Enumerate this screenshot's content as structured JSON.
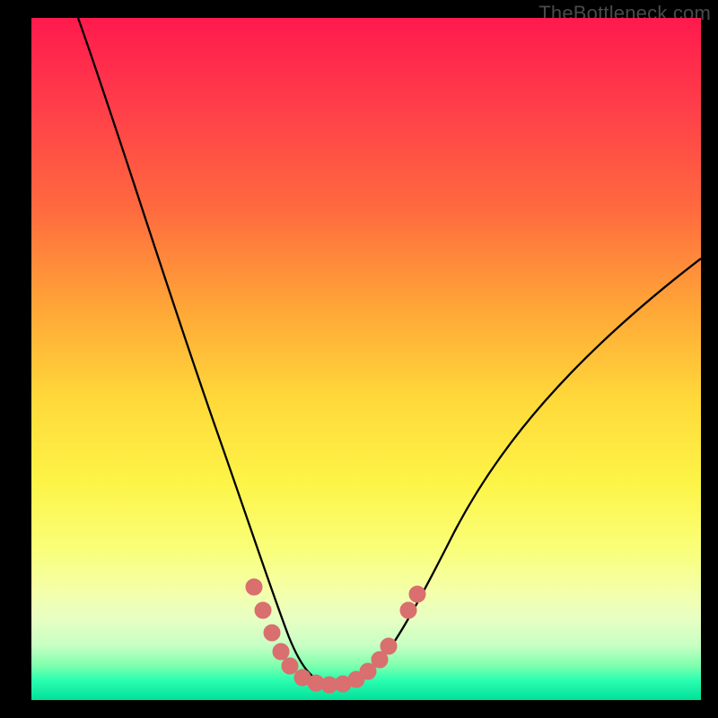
{
  "watermark": {
    "text": "TheBottleneck.com"
  },
  "colors": {
    "frame": "#000000",
    "curve": "#000000",
    "marker": "#d96f6e",
    "gradient_top": "#ff1a4d",
    "gradient_bottom": "#00e09a"
  },
  "chart_data": {
    "type": "line",
    "title": "",
    "xlabel": "",
    "ylabel": "",
    "xlim": [
      0,
      100
    ],
    "ylim": [
      0,
      100
    ],
    "grid": false,
    "legend": false,
    "note": "Stylized bottleneck curve over a heat gradient; no numeric axis labels are displayed. Values below are visual-proportion estimates (0–100 normalized).",
    "series": [
      {
        "name": "bottleneck-curve",
        "x": [
          7,
          10,
          14,
          18,
          22,
          26,
          30,
          33,
          35,
          37,
          39,
          41,
          43,
          47,
          50,
          53,
          56,
          60,
          66,
          74,
          82,
          90,
          98
        ],
        "values": [
          100,
          86,
          72,
          58,
          46,
          35,
          25,
          17,
          12,
          8,
          5,
          3,
          2,
          2,
          3,
          5,
          9,
          15,
          26,
          40,
          52,
          60,
          65
        ]
      }
    ],
    "markers": [
      {
        "name": "left-foot-a",
        "x": 33.0,
        "y": 16.0
      },
      {
        "name": "left-foot-b",
        "x": 34.7,
        "y": 12.0
      },
      {
        "name": "left-foot-c",
        "x": 36.0,
        "y": 8.5
      },
      {
        "name": "left-foot-d",
        "x": 37.3,
        "y": 5.5
      },
      {
        "name": "left-foot-e",
        "x": 38.6,
        "y": 3.6
      },
      {
        "name": "bottom-a",
        "x": 40.5,
        "y": 2.4
      },
      {
        "name": "bottom-b",
        "x": 42.5,
        "y": 2.0
      },
      {
        "name": "bottom-c",
        "x": 44.5,
        "y": 2.0
      },
      {
        "name": "bottom-d",
        "x": 46.5,
        "y": 2.0
      },
      {
        "name": "bottom-e",
        "x": 48.5,
        "y": 2.4
      },
      {
        "name": "right-foot-a",
        "x": 50.3,
        "y": 3.2
      },
      {
        "name": "right-foot-b",
        "x": 52.0,
        "y": 5.0
      },
      {
        "name": "right-foot-c",
        "x": 53.3,
        "y": 7.8
      },
      {
        "name": "right-gap-a",
        "x": 56.4,
        "y": 13.5
      },
      {
        "name": "right-gap-b",
        "x": 57.6,
        "y": 16.0
      }
    ]
  }
}
